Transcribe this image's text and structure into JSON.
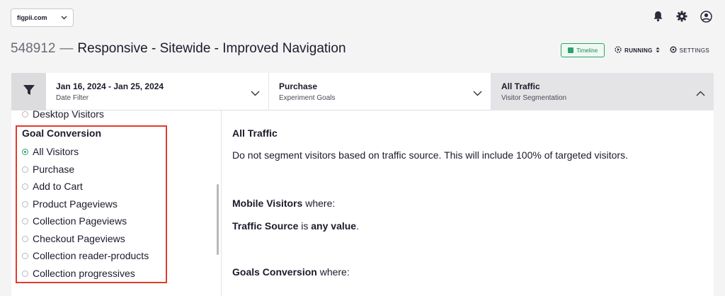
{
  "topbar": {
    "site_select": "figpii.com",
    "icons": [
      "bell-icon",
      "gear-icon",
      "user-icon"
    ]
  },
  "experiment": {
    "id": "548912",
    "separator": "—",
    "name": "Responsive - Sitewide - Improved Navigation",
    "timeline_label": "Timeline",
    "status_label": "RUNNING",
    "settings_label": "SETTINGS"
  },
  "filters": {
    "date": {
      "main": "Jan 16, 2024 - Jan 25, 2024",
      "sub": "Date Filter"
    },
    "goals": {
      "main": "Purchase",
      "sub": "Experiment Goals"
    },
    "traffic": {
      "main": "All Traffic",
      "sub": "Visitor Segmentation"
    }
  },
  "segments": {
    "partial_item": "Desktop Visitors",
    "goal_header": "Goal Conversion",
    "items": [
      {
        "label": "All Visitors",
        "checked": true
      },
      {
        "label": "Purchase",
        "checked": false
      },
      {
        "label": "Add to Cart",
        "checked": false
      },
      {
        "label": "Product Pageviews",
        "checked": false
      },
      {
        "label": "Collection Pageviews",
        "checked": false
      },
      {
        "label": "Checkout Pageviews",
        "checked": false
      },
      {
        "label": "Collection reader-products",
        "checked": false
      },
      {
        "label": "Collection progressives",
        "checked": false
      }
    ]
  },
  "detail": {
    "title": "All Traffic",
    "description": "Do not segment visitors based on traffic source. This will include 100% of targeted visitors.",
    "mobile_label": "Mobile Visitors",
    "mobile_suffix": " where:",
    "traffic_label": "Traffic Source",
    "traffic_is": " is ",
    "traffic_value": "any value",
    "traffic_end": ".",
    "goals_label": "Goals Conversion",
    "goals_suffix": " where:"
  },
  "colors": {
    "accent_green": "#2ca36b",
    "highlight_red": "#e23c2c"
  }
}
